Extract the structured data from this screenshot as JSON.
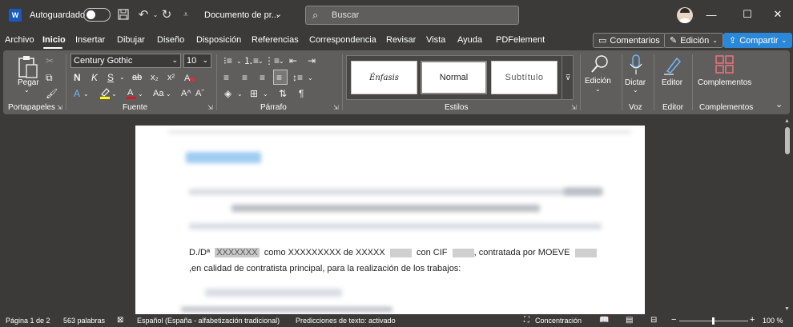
{
  "titlebar": {
    "app_icon": "word-logo-icon",
    "autosave_label": "Autoguardado",
    "autosave_on": false,
    "doc_name": "Documento de pr...",
    "search_placeholder": "Buscar"
  },
  "tabs": [
    "Archivo",
    "Inicio",
    "Insertar",
    "Dibujar",
    "Diseño",
    "Disposición",
    "Referencias",
    "Correspondencia",
    "Revisar",
    "Vista",
    "Ayuda",
    "PDFelement"
  ],
  "active_tab": "Inicio",
  "top_buttons": {
    "comments": "Comentarios",
    "editing": "Edición",
    "share": "Compartir"
  },
  "ribbon": {
    "clipboard": {
      "paste": "Pegar",
      "label": "Portapapeles"
    },
    "font": {
      "family": "Century Gothic",
      "size": "10",
      "bold": "N",
      "italic": "K",
      "underline": "S",
      "strike": "ab",
      "sub": "x₂",
      "sup": "x²",
      "case": "Aa",
      "grow": "A^",
      "shrink": "Aˇ",
      "label": "Fuente"
    },
    "paragraph": {
      "label": "Párrafo"
    },
    "styles": {
      "items": [
        "Énfasis",
        "Normal",
        "Subtítulo"
      ],
      "selected": "Normal",
      "label": "Estilos"
    },
    "editing": {
      "label": "Edición"
    },
    "voice": {
      "dictate": "Dictar",
      "label": "Voz"
    },
    "editor": {
      "button": "Editor",
      "label": "Editor"
    },
    "addins": {
      "button": "Complementos",
      "label": "Complementos"
    }
  },
  "document": {
    "line1": {
      "a": "D./Dª",
      "b": "XXXXXXX",
      "c": "como XXXXXXXXX de XXXXX",
      "d": "con CIF",
      "e": ", contratada por MOEVE"
    },
    "line2": ",en calidad de contratista principal, para la realización de los trabajos:"
  },
  "status": {
    "page": "Página 1 de 2",
    "words": "563 palabras",
    "language": "Español (España - alfabetización tradicional)",
    "predictions": "Predicciones de texto: activado",
    "focus": "Concentración",
    "zoom": "100 %",
    "zoom_percent": 100
  }
}
